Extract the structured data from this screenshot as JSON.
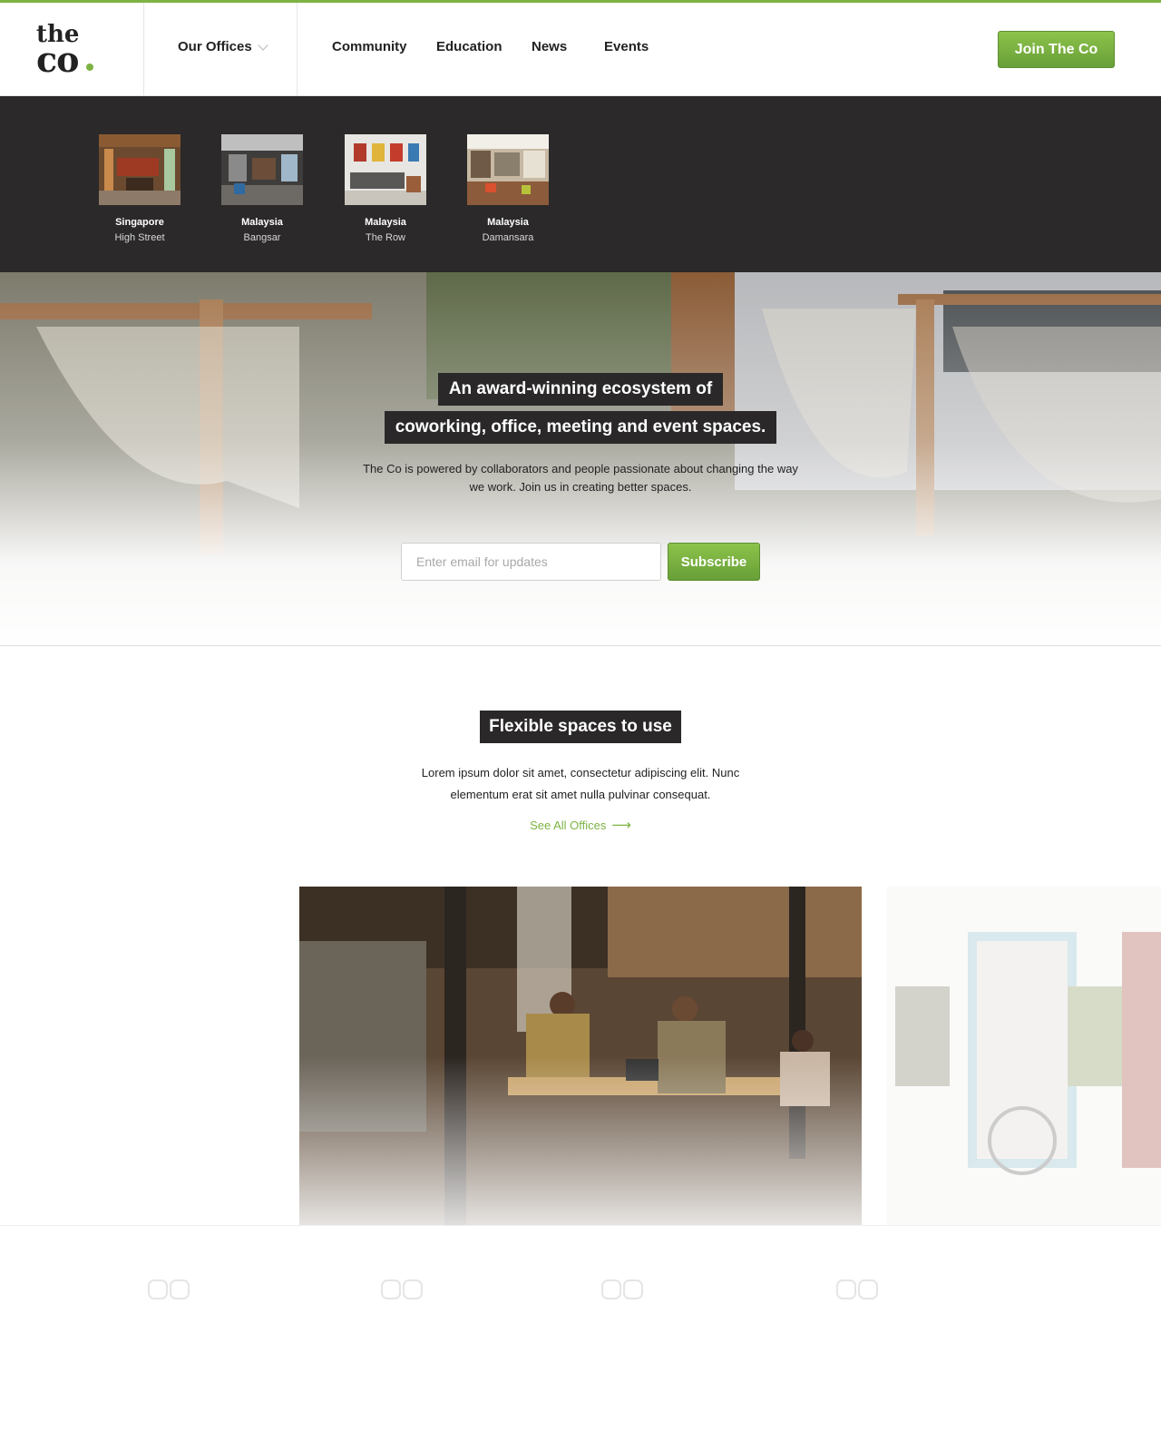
{
  "header": {
    "logo_top": "the",
    "logo_bottom": "co",
    "offices_label": "Our Offices",
    "nav": [
      "Community",
      "Education",
      "News",
      "Events"
    ],
    "cta_label": "Join The Co"
  },
  "offices": [
    {
      "country": "Singapore",
      "branch": "High Street"
    },
    {
      "country": "Malaysia",
      "branch": "Bangsar"
    },
    {
      "country": "Malaysia",
      "branch": "The Row"
    },
    {
      "country": "Malaysia",
      "branch": "Damansara"
    }
  ],
  "hero": {
    "headline_line1": "An award-winning ecosystem of",
    "headline_line2": "coworking, office, meeting and event spaces.",
    "copy": "The Co is powered by collaborators and people passionate about changing the way we work. Join us in creating better spaces.",
    "email_placeholder": "Enter email for updates",
    "subscribe_label": "Subscribe"
  },
  "flexible": {
    "title": "Flexible spaces to use",
    "copy": "Lorem ipsum dolor sit amet, consectetur adipiscing elit. Nunc elementum erat sit amet nulla pulvinar consequat.",
    "link_label": "See All Offices"
  },
  "colors": {
    "brand_green": "#7cb342",
    "dark_band": "#2b292a"
  },
  "icons": {
    "offices_chevron": "chevron-down-icon",
    "see_all_arrow": "arrow-right-icon"
  }
}
